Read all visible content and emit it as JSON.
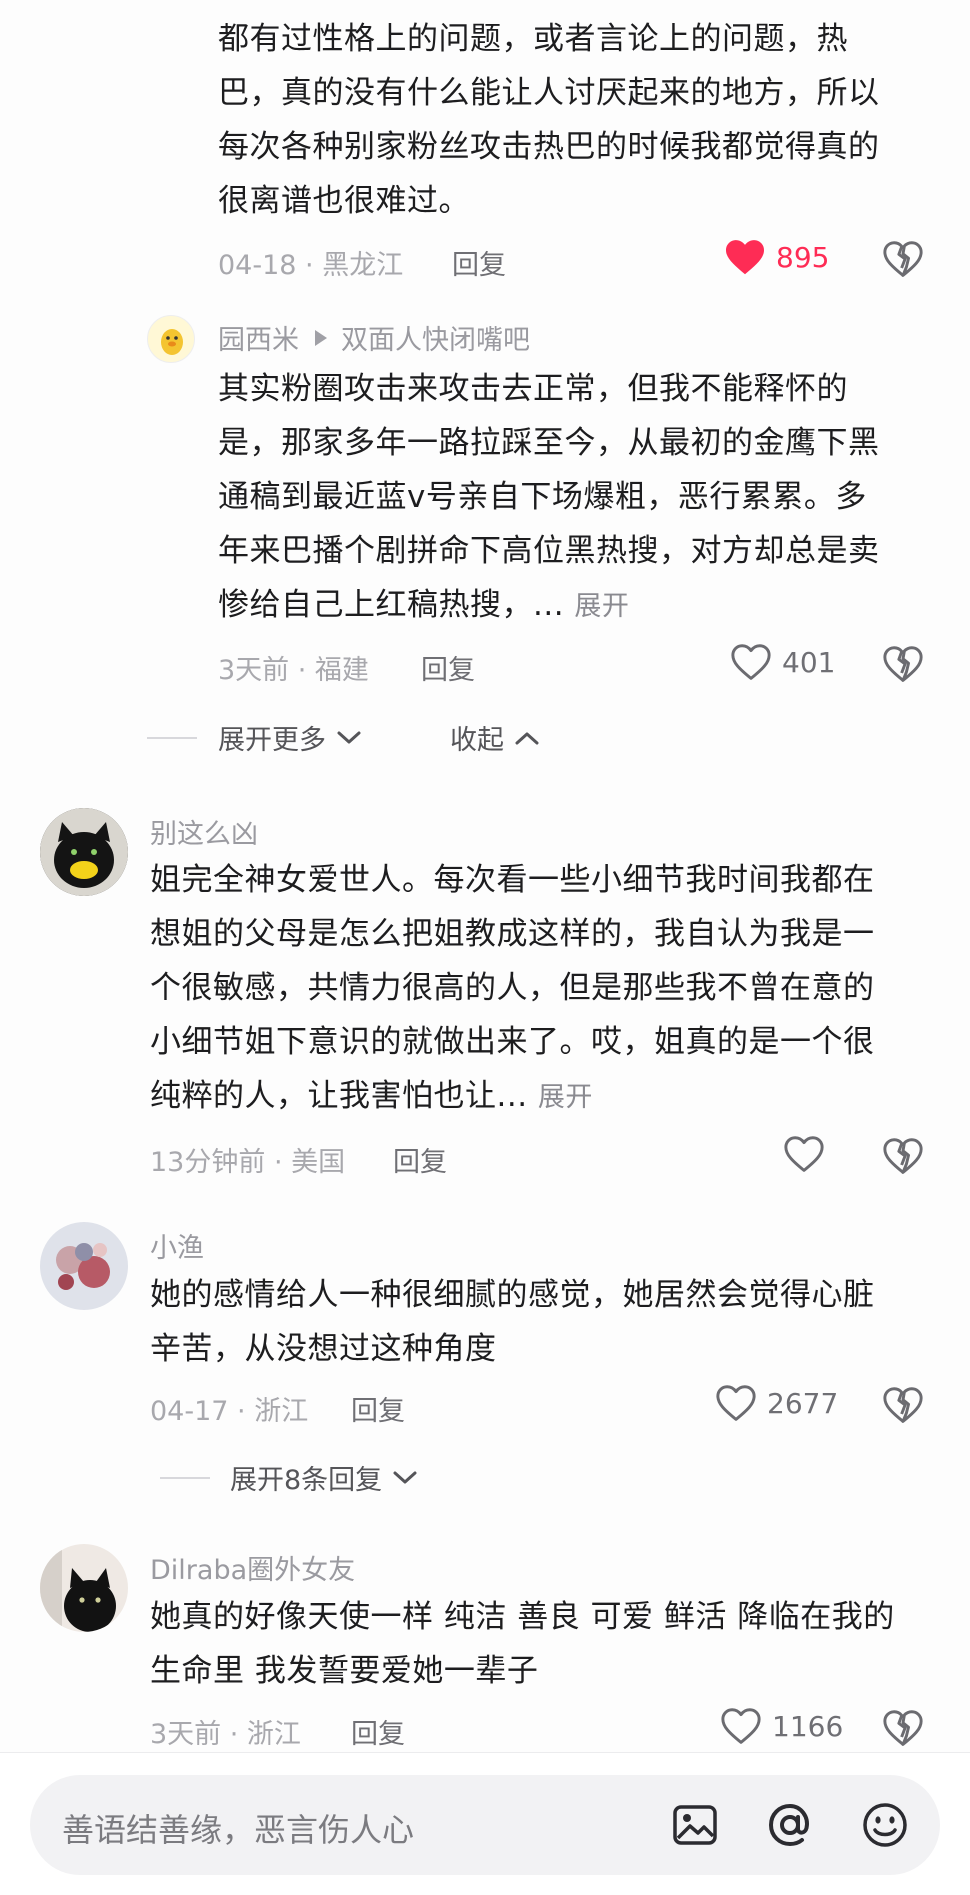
{
  "comments": [
    {
      "text_lines": [
        "都有过性格上的问题，或者言论上的问题，热",
        "巴，真的没有什么能让人讨厌起来的地方，所以",
        "每次各种别家粉丝攻击热巴的时候我都觉得真的",
        "很离谱也很难过。"
      ],
      "date_region": "04-18 · 黑龙江",
      "reply_label": "回复",
      "likes": "895",
      "liked": true
    },
    {
      "author": "园西米",
      "reply_to": "双面人快闭嘴吧",
      "text_lines": [
        "其实粉圈攻击来攻击去正常，但我不能释怀的",
        "是，那家多年一路拉踩至今，从最初的金鹰下黑",
        "通稿到最近蓝v号亲自下场爆粗，恶行累累。多",
        "年来巴播个剧拼命下高位黑热搜，对方却总是卖",
        "惨给自己上红稿热搜，..."
      ],
      "expand_label": "展开",
      "date_region": "3天前 · 福建",
      "reply_label": "回复",
      "likes": "401"
    },
    {
      "author": "别这么凶",
      "text_lines": [
        "姐完全神女爱世人。每次看一些小细节我时间我都在",
        "想姐的父母是怎么把姐教成这样的，我自认为我是一",
        "个很敏感，共情力很高的人，但是那些我不曾在意的",
        "小细节姐下意识的就做出来了。哎，姐真的是一个很",
        "纯粹的人，让我害怕也让..."
      ],
      "expand_label": "展开",
      "date_region": "13分钟前 · 美国",
      "reply_label": "回复",
      "likes": ""
    },
    {
      "author": "小渔",
      "text_lines": [
        "她的感情给人一种很细腻的感觉，她居然会觉得心脏",
        "辛苦，从没想过这种角度"
      ],
      "date_region": "04-17 · 浙江",
      "reply_label": "回复",
      "likes": "2677"
    },
    {
      "author": "Dilraba圈外女友",
      "text_lines": [
        "她真的好像天使一样 纯洁 善良 可爱 鲜活 降临在我的",
        "生命里 我发誓要爱她一辈子"
      ],
      "date_region": "3天前 · 浙江",
      "reply_label": "回复",
      "likes": "1166"
    }
  ],
  "toggles": {
    "expand_more": "展开更多",
    "collapse": "收起",
    "expand_replies": "展开8条回复"
  },
  "composer": {
    "placeholder": "善语结善缘，恶言伤人心"
  },
  "icons": {
    "like": "heart-outline-icon",
    "liked": "heart-filled-icon",
    "dislike": "broken-heart-icon",
    "image": "image-icon",
    "mention": "at-icon",
    "emoji": "emoji-icon"
  },
  "colors": {
    "liked_accent": "#fe2c55",
    "text": "#1d1d1f",
    "meta": "#a8a8ad"
  }
}
